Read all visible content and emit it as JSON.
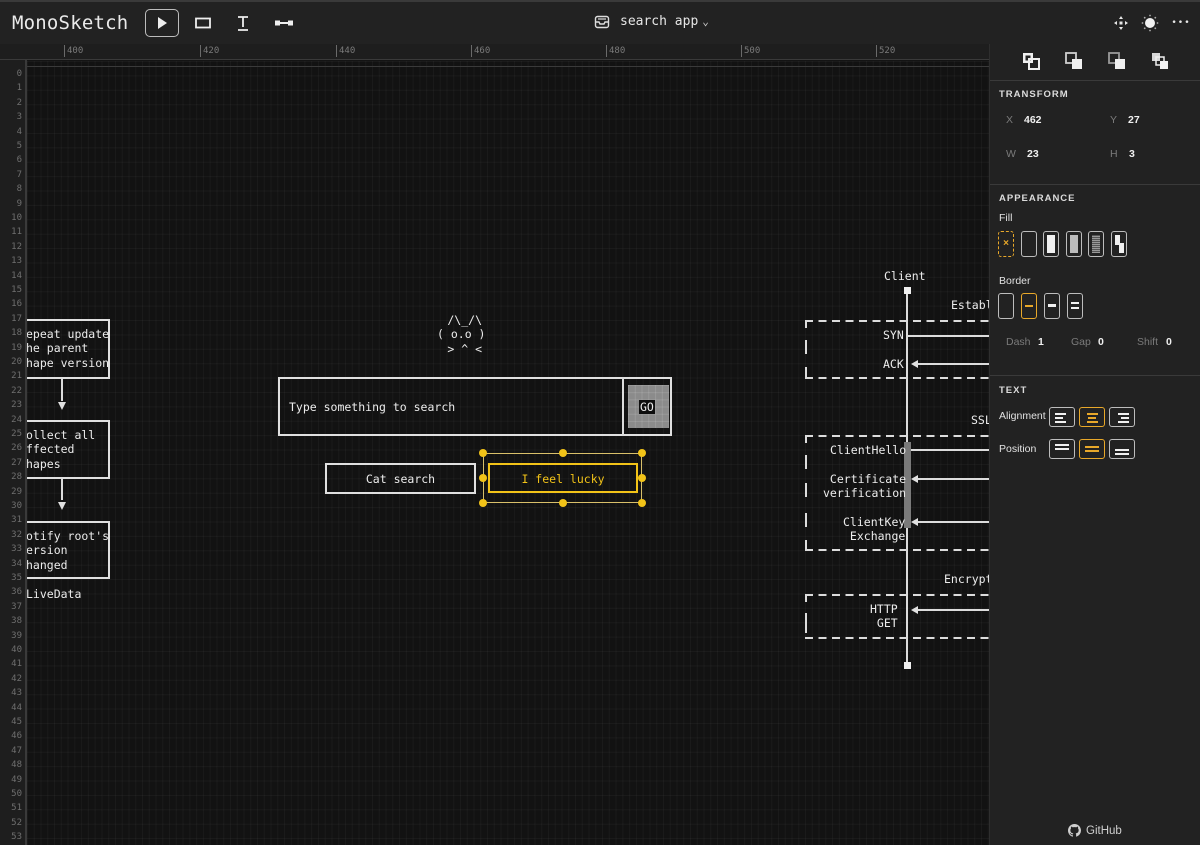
{
  "app": {
    "title": "MonoSketch"
  },
  "toolbar": {
    "tools": [
      {
        "name": "select",
        "icon": "pointer-icon",
        "active": true
      },
      {
        "name": "rectangle",
        "icon": "rectangle-icon",
        "active": false
      },
      {
        "name": "text",
        "icon": "text-icon",
        "active": false
      },
      {
        "name": "line",
        "icon": "line-icon",
        "active": false
      }
    ],
    "project_icon": "inbox-icon",
    "project_name": "search app",
    "project_chevron": "⌄",
    "right_icons": [
      "move-icon",
      "theme-sun-icon",
      "more-icon"
    ],
    "more_glyph": "•••"
  },
  "ruler": {
    "horizontal": [
      "400",
      "420",
      "440",
      "460",
      "480",
      "500",
      "520"
    ],
    "vertical": [
      "0",
      "1",
      "2",
      "3",
      "4",
      "5",
      "6",
      "7",
      "8",
      "9",
      "10",
      "11",
      "12",
      "13",
      "14",
      "15",
      "16",
      "17",
      "18",
      "19",
      "20",
      "21",
      "22",
      "23",
      "24",
      "25",
      "26",
      "27",
      "28",
      "29",
      "30",
      "31",
      "32",
      "33",
      "34",
      "35",
      "36",
      "37",
      "38",
      "39",
      "40",
      "41",
      "42",
      "43",
      "44",
      "45",
      "46",
      "47",
      "48",
      "49",
      "50",
      "51",
      "52",
      "53"
    ]
  },
  "canvas": {
    "flow": {
      "box1": "epeat update\nhe parent\nhape version",
      "box2": "ollect all\nffected\nhapes",
      "box3": "otify root's\nersion\nhanged",
      "footer": "LiveData"
    },
    "cat_art": " /\\_/\\\n( o.o )\n > ^ <",
    "search_box": {
      "placeholder": "Type something to search",
      "go_label": "GO"
    },
    "buttons": {
      "cat_search": "Cat search",
      "feel_lucky": "I feel lucky"
    },
    "sequence": {
      "participant": "Client",
      "section1": "Establ",
      "syn": "SYN",
      "ack": "ACK",
      "section2": "SSL",
      "client_hello": "ClientHello",
      "cert_verification": "Certificate\nverification",
      "client_key_exchange": "ClientKey\n Exchange",
      "section3": "Encrypt",
      "http_get": "HTTP\n GET"
    }
  },
  "panel": {
    "arrange_icons": [
      "bring-forward-icon",
      "send-backward-icon",
      "bring-to-front-icon",
      "send-to-back-icon"
    ],
    "transform": {
      "title": "TRANSFORM",
      "x_label": "X",
      "x_value": "462",
      "y_label": "Y",
      "y_value": "27",
      "w_label": "W",
      "w_value": "23",
      "h_label": "H",
      "h_value": "3"
    },
    "appearance": {
      "title": "APPEARANCE",
      "fill_label": "Fill",
      "fill_options": [
        "none",
        "transparent",
        "solid",
        "light-dots",
        "dense-dots",
        "stripe"
      ],
      "fill_selected": "none",
      "fill_none_glyph": "×",
      "border_label": "Border",
      "border_options": [
        "none",
        "single",
        "bold",
        "double"
      ],
      "border_selected": "single",
      "dash_label": "Dash",
      "dash_value": "1",
      "gap_label": "Gap",
      "gap_value": "0",
      "shift_label": "Shift",
      "shift_value": "0"
    },
    "text": {
      "title": "TEXT",
      "alignment_label": "Alignment",
      "alignment_options": [
        "left",
        "center",
        "right"
      ],
      "alignment_selected": "center",
      "position_label": "Position",
      "position_options": [
        "top",
        "middle",
        "bottom"
      ],
      "position_selected": "middle"
    },
    "footer_link": "GitHub"
  },
  "colors": {
    "accent": "#f2c318",
    "selection_accent": "#e8a82a",
    "canvas_bg": "#121212",
    "panel_bg": "#222222"
  }
}
